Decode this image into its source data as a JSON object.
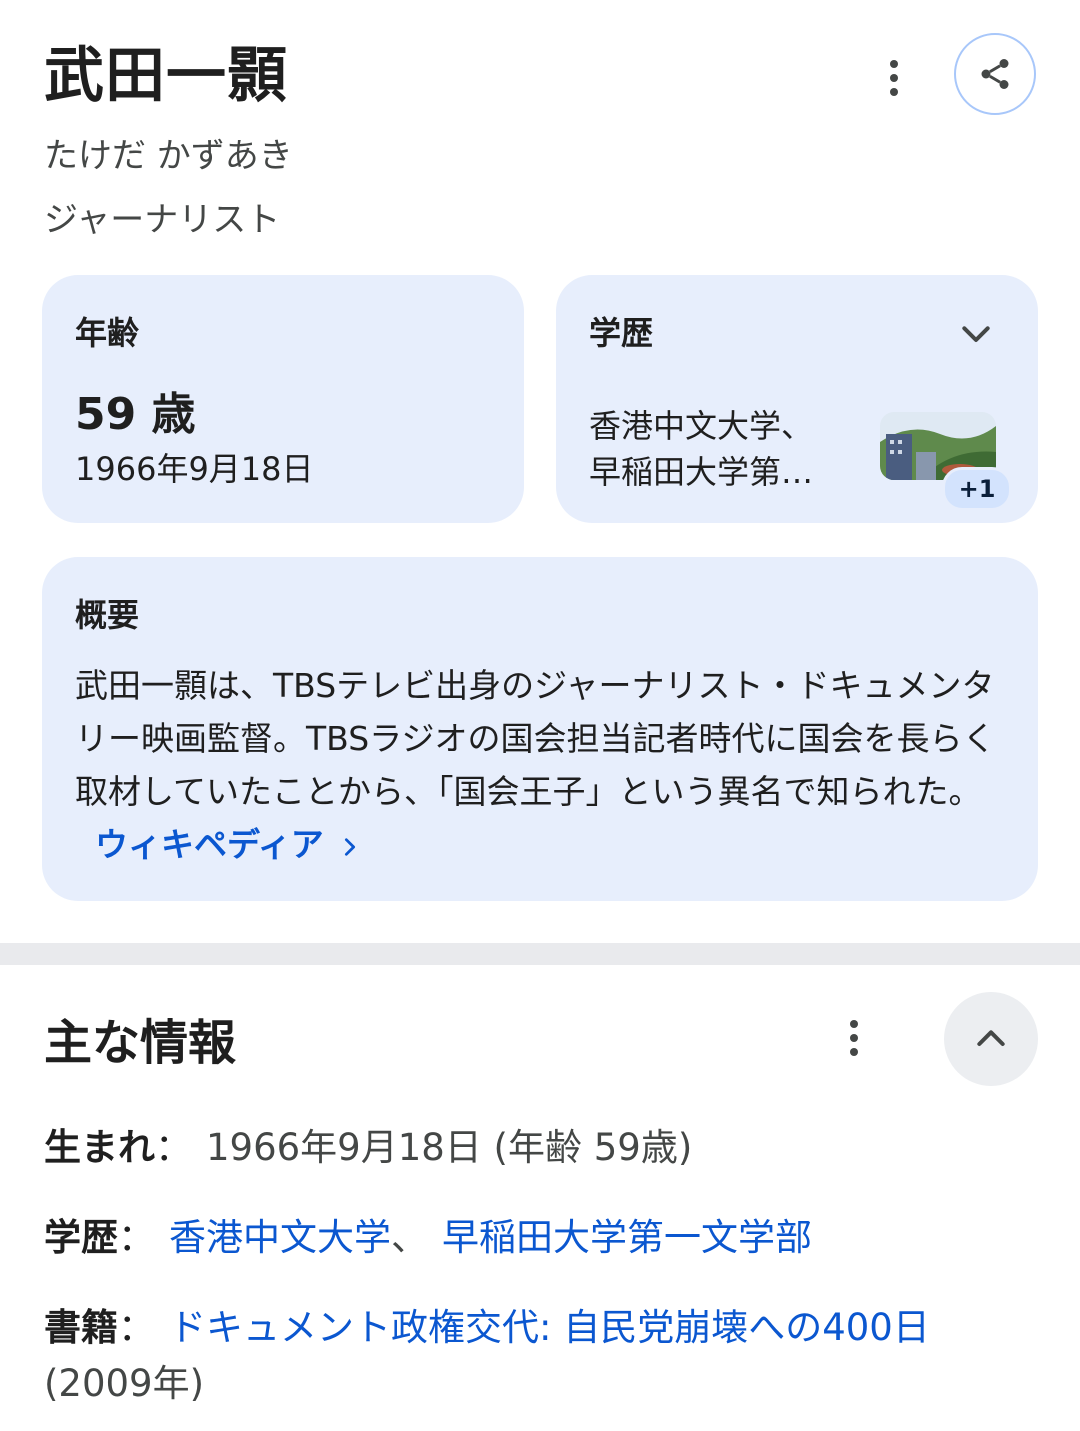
{
  "header": {
    "name": "武田一顥",
    "reading": "たけだ かずあき",
    "occupation": "ジャーナリスト"
  },
  "age_card": {
    "label": "年齢",
    "value": "59 歳",
    "date": "1966年9月18日"
  },
  "education_card": {
    "label": "学歴",
    "line1": "香港中文大学、",
    "line2": "早稲田大学第…",
    "more_badge": "+1"
  },
  "summary_card": {
    "label": "概要",
    "text": "武田一顥は、TBSテレビ出身のジャーナリスト・ドキュメンタリー映画監督。TBSラジオの国会担当記者時代に国会を長らく取材していたことから、「国会王子」という異名で知られた。",
    "link_label": "ウィキペディア"
  },
  "key_info": {
    "title": "主な情報",
    "born_label": "生まれ",
    "born_value": "1966年9月18日 (年齢 59歳)",
    "education_label": "学歴",
    "education_link1": "香港中文大学",
    "education_sep": "、",
    "education_link2": "早稲田大学第一文学部",
    "books_label": "書籍",
    "books_link": "ドキュメント政権交代: 自民党崩壊への400日",
    "books_year": "(2009年)",
    "colon": "："
  },
  "colors": {
    "card_bg": "#e7eefc",
    "link": "#0b57d0",
    "divider": "#e9eaed"
  },
  "icons": [
    "more-vert-icon",
    "share-icon",
    "chevron-down-icon",
    "chevron-right-icon",
    "chevron-up-icon"
  ]
}
